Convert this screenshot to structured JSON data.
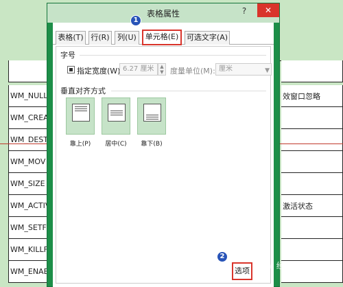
{
  "dialog": {
    "title": "表格属性",
    "help": "?",
    "close": "✕",
    "tabs": [
      {
        "label": "表格(T)"
      },
      {
        "label": "行(R)"
      },
      {
        "label": "列(U)"
      },
      {
        "label": "单元格(E)"
      },
      {
        "label": "可选文字(A)"
      }
    ],
    "size_section": "字号",
    "preferred_width": {
      "label": "指定宽度(W):",
      "value": "6.27 厘米",
      "checked": true
    },
    "measure_in": {
      "label": "度量单位(M):",
      "value": "厘米"
    },
    "vertical_alignment_section": "垂直对齐方式",
    "alignments": [
      {
        "label": "靠上(P)"
      },
      {
        "label": "居中(C)"
      },
      {
        "label": "靠下(B)"
      }
    ],
    "options_button": "选项"
  },
  "badges": [
    "1",
    "2"
  ],
  "document": {
    "rows": [
      "WM_NULL",
      "WM_CREA",
      "WM_DEST",
      "WM_MOV",
      "WM_SIZE",
      "WM_ACTIV",
      "WM_SETF",
      "WM_KILLF",
      "WM_ENAE"
    ],
    "right_col": [
      "效窗口忽略",
      "",
      "",
      "",
      "",
      "激活状态",
      "",
      "",
      ""
    ]
  },
  "watermark": "Bai 经验",
  "colors": {
    "accent": "#1d8e48",
    "highlight": "#d9342b",
    "badge": "#2854b8"
  }
}
